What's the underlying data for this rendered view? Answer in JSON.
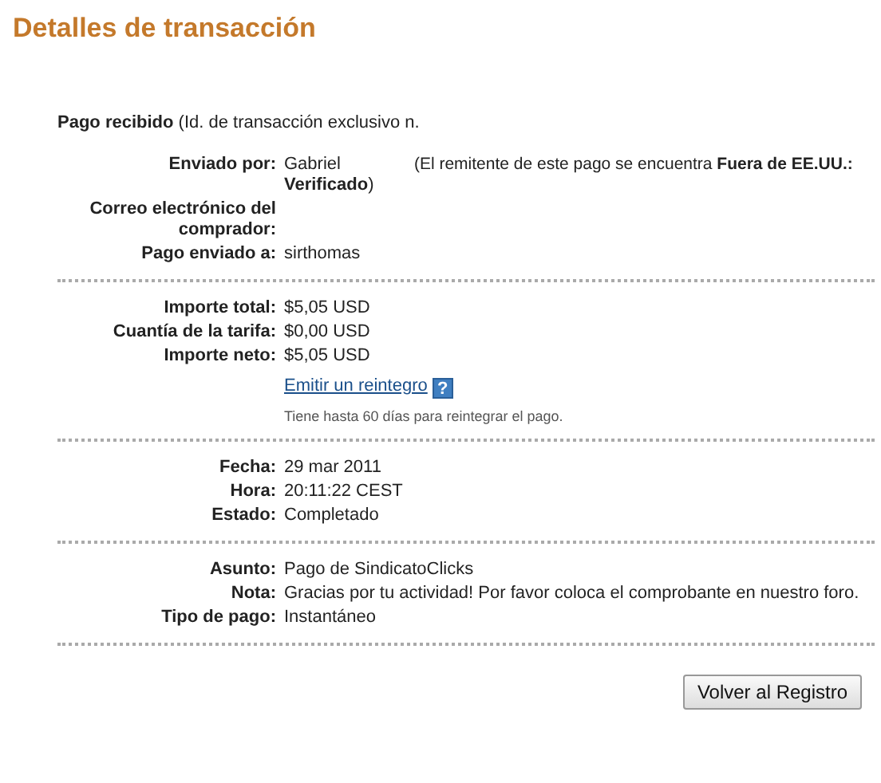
{
  "title": "Detalles de transacción",
  "intro": "**Pago recibido** (Id. de transacción exclusivo n.",
  "sections": [
    {
      "rows": [
        {
          "kind": "sender",
          "label": "Enviado por:",
          "value": "Gabriel",
          "note": "(El remitente de este pago se encuentra **Fuera de EE.UU.:**",
          "status": "**Verificado**)"
        },
        {
          "kind": "text",
          "label": "Correo electrónico del comprador:",
          "value": ""
        },
        {
          "kind": "text",
          "label": "Pago enviado a:",
          "value": "sirthomas"
        }
      ]
    },
    {
      "rows": [
        {
          "kind": "text",
          "label": "Importe total:",
          "value": "$5,05 USD"
        },
        {
          "kind": "text",
          "label": "Cuantía de la tarifa:",
          "value": "$0,00 USD"
        },
        {
          "kind": "text",
          "label": "Importe neto:",
          "value": "$5,05 USD"
        }
      ],
      "refund": {
        "link": "Emitir un reintegro",
        "help": "?",
        "hint": "Tiene hasta 60 días para reintegrar el pago."
      }
    },
    {
      "rows": [
        {
          "kind": "text",
          "label": "Fecha:",
          "value": "29 mar 2011"
        },
        {
          "kind": "text",
          "label": "Hora:",
          "value": "20:11:22 CEST"
        },
        {
          "kind": "text",
          "label": "Estado:",
          "value": "Completado"
        }
      ]
    },
    {
      "rows": [
        {
          "kind": "text",
          "label": "Asunto:",
          "value": "Pago de SindicatoClicks"
        },
        {
          "kind": "text",
          "label": "Nota:",
          "value": "Gracias por tu actividad! Por favor coloca el comprobante en nuestro foro."
        },
        {
          "kind": "text",
          "label": "Tipo de pago:",
          "value": "Instantáneo"
        }
      ]
    }
  ],
  "button": "Volver al Registro"
}
